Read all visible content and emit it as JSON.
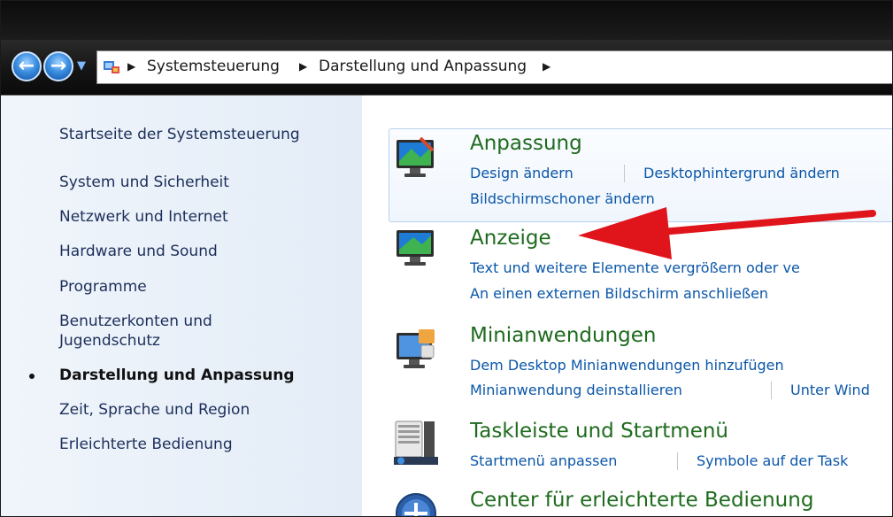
{
  "breadcrumb": {
    "items": [
      "Systemsteuerung",
      "Darstellung und Anpassung"
    ]
  },
  "sidebar": {
    "items": [
      {
        "label": "Startseite der Systemsteuerung"
      },
      {
        "label": "System und Sicherheit"
      },
      {
        "label": "Netzwerk und Internet"
      },
      {
        "label": "Hardware und Sound"
      },
      {
        "label": "Programme"
      },
      {
        "label": "Benutzerkonten und"
      },
      {
        "label": "Jugendschutz"
      },
      {
        "label": "Darstellung und Anpassung"
      },
      {
        "label": "Zeit, Sprache und Region"
      },
      {
        "label": "Erleichterte Bedienung"
      }
    ]
  },
  "categories": [
    {
      "title": "Anpassung",
      "links": [
        "Design ändern",
        "Desktophintergrund ändern",
        "Bildschirmschoner ändern"
      ]
    },
    {
      "title": "Anzeige",
      "links": [
        "Text und weitere Elemente vergrößern oder ve",
        "An einen externen Bildschirm anschließen"
      ]
    },
    {
      "title": "Minianwendungen",
      "links": [
        "Dem Desktop Minianwendungen hinzufügen",
        "Minianwendung deinstallieren",
        "Unter Wind"
      ]
    },
    {
      "title": "Taskleiste und Startmenü",
      "links": [
        "Startmenü anpassen",
        "Symbole auf der Task"
      ]
    },
    {
      "title": "Center für erleichterte Bedienung",
      "links": []
    }
  ],
  "colors": {
    "accent_green": "#1e6b1e",
    "link_blue": "#0b57a8",
    "arrow_red": "#e0151b"
  }
}
